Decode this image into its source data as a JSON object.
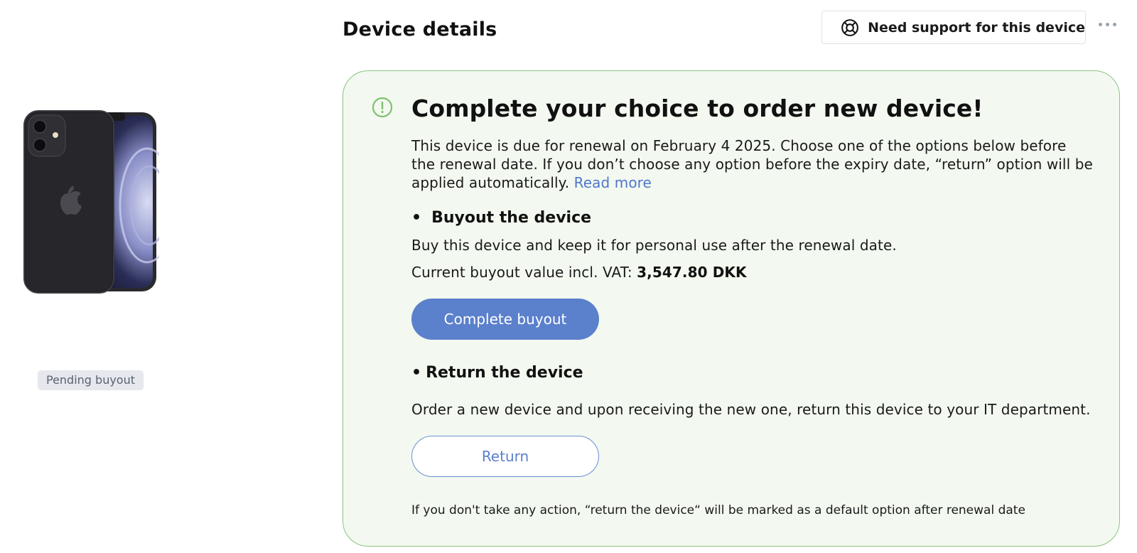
{
  "header": {
    "title": "Device details",
    "support_label": "Need support for this device"
  },
  "device": {
    "status_badge": "Pending buyout"
  },
  "renewal_card": {
    "title": "Complete your choice to order new device!",
    "intro": "This device is due for renewal on February 4 2025. Choose one of the options below before the renewal date. If you don’t choose any option before the expiry date, “return” option will be applied automatically.",
    "read_more": "Read more",
    "buyout": {
      "bullet": "•",
      "heading": "Buyout the device",
      "description": "Buy this device and keep it for personal use after the renewal date.",
      "value_label": "Current buyout value incl. VAT:",
      "value_amount": "3,547.80 DKK",
      "button_label": "Complete buyout"
    },
    "return": {
      "bullet": "•",
      "heading": "Return the device",
      "description": "Order a new device and upon receiving the new one, return this device to your IT department.",
      "button_label": "Return"
    },
    "footnote": "If you don't take any action, “return the device“ will be marked as a default option after renewal date"
  },
  "colors": {
    "card_background": "#f3f9f0",
    "card_border": "#8cc384",
    "primary_button": "#5b80cc",
    "link": "#4f76cc",
    "badge_background": "#e6e8ed"
  },
  "icons": {
    "support": "lifebuoy-icon",
    "more": "more-horizontal-icon",
    "alert": "exclamation-circle-icon"
  }
}
